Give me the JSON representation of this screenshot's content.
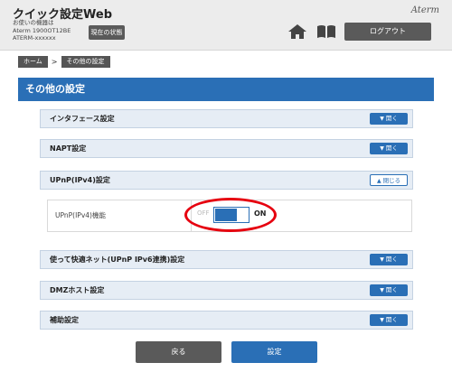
{
  "header": {
    "title": "クイック設定Web",
    "device_line1": "お使いの機器は",
    "device_line2": "Aterm 1900OT12BE",
    "device_line3": "ATERM-xxxxxx",
    "status_button": "現在の状態",
    "logo": "Aterm",
    "logout_button": "ログアウト",
    "icons": [
      "home-icon",
      "book-icon"
    ]
  },
  "breadcrumb": {
    "home": "ホーム",
    "separator": ">",
    "current": "その他の設定"
  },
  "page": {
    "title": "その他の設定"
  },
  "sections": [
    {
      "label": "インタフェース設定",
      "button": "開く",
      "expanded": false
    },
    {
      "label": "NAPT設定",
      "button": "開く",
      "expanded": false
    },
    {
      "label": "UPnP(IPv4)設定",
      "button": "閉じる",
      "expanded": true
    },
    {
      "label": "使って快適ネット(UPnP IPv6連携)設定",
      "button": "開く",
      "expanded": false
    },
    {
      "label": "DMZホスト設定",
      "button": "開く",
      "expanded": false
    },
    {
      "label": "補助設定",
      "button": "開く",
      "expanded": false
    }
  ],
  "upnp_panel": {
    "label": "UPnP(IPv4)機能",
    "off_text": "OFF",
    "on_text": "ON",
    "state": "ON"
  },
  "buttons": {
    "back": "戻る",
    "set": "設定"
  },
  "colors": {
    "accent": "#2a6fb6",
    "dark_button": "#5a5a5a",
    "highlight": "#e6000f"
  }
}
